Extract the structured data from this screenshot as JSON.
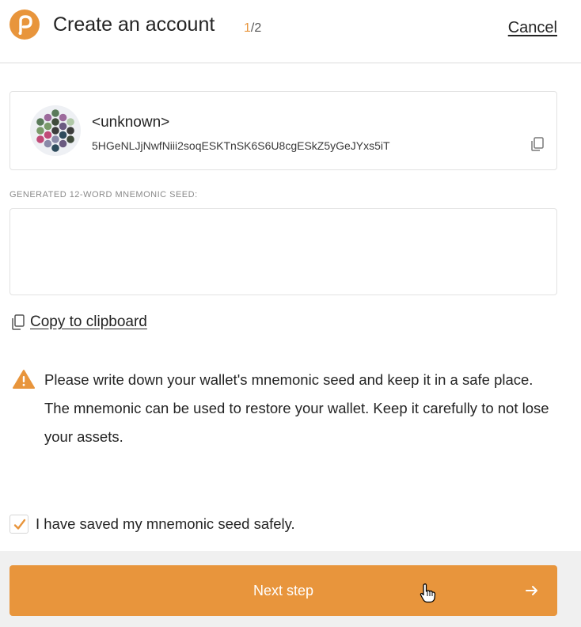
{
  "header": {
    "title": "Create an account",
    "step_current": "1",
    "step_total": "/2",
    "cancel_label": "Cancel"
  },
  "account": {
    "name": "<unknown>",
    "address": "5HGeNLJjNwfNiii2soqESKTnSK6S6U8cgESkZ5yGeJYxs5iT",
    "identicon_colors": [
      "#3c3c3c",
      "#2e4b5c",
      "#7a9a6a",
      "#b0c8a8",
      "#6a5a80",
      "#c04a78",
      "#9c6a9c",
      "#404c3c",
      "#8a8aa8",
      "#5a7a5a"
    ]
  },
  "seed": {
    "label": "GENERATED 12-WORD MNEMONIC SEED:",
    "value": "",
    "copy_label": "Copy to clipboard"
  },
  "warning": {
    "text": "Please write down your wallet's mnemonic seed and keep it in a safe place. The mnemonic can be used to restore your wallet. Keep it carefully to not lose your assets."
  },
  "confirm": {
    "label": "I have saved my mnemonic seed safely.",
    "checked": true
  },
  "footer": {
    "next_label": "Next step"
  },
  "colors": {
    "accent": "#e8953c",
    "border": "#e2e2e2",
    "text": "#242424"
  }
}
